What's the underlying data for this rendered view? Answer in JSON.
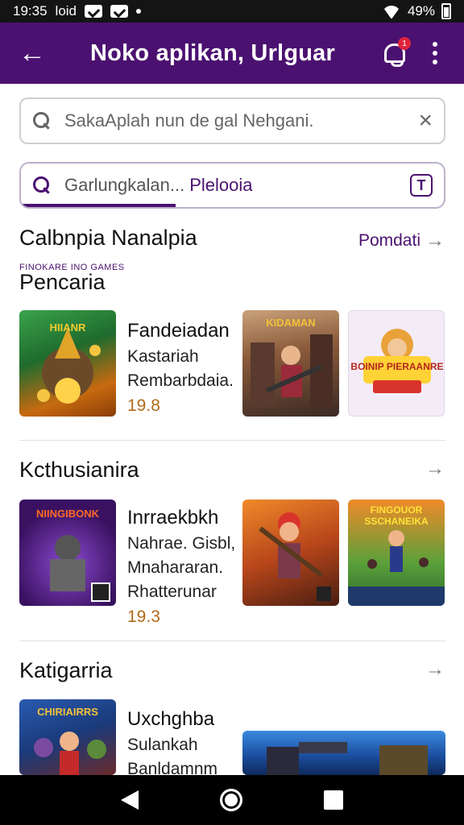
{
  "status_bar": {
    "time": "19:35",
    "net": "loid",
    "battery": "49%"
  },
  "app_bar": {
    "title": "Noko aplikan,  Urlguar",
    "badge_count": "1"
  },
  "search_primary": {
    "placeholder": "SakaAplah nun de gal Nehgani."
  },
  "search_secondary": {
    "text": "Garlungkalan...",
    "highlight": "Plelooia"
  },
  "section_top": {
    "title": "Calbnpia Nanalpia",
    "link": "Pomdati",
    "sub_label": "FINOKARE INO GAMES",
    "sub_title": "Pencaria"
  },
  "rows": [
    {
      "title": "Fandeiadan",
      "line2": "Kastariah",
      "line3": "Rembarbdaia.",
      "rating": "19.8",
      "tiles": [
        "HIIANR",
        "KIDAMAN",
        "BOINIP PIERAANRE"
      ]
    },
    {
      "section": "Kcthusianira",
      "title": "Inrraekbkh",
      "line2": "Nahrae. Gisbl,",
      "line3": "Mnahararan.",
      "line4": "Rhatterunar",
      "rating": "19.3",
      "tiles": [
        "NIINGIBONK",
        "",
        "FINGOUOR SSCHANEIKA"
      ]
    },
    {
      "section": "Katigarria",
      "title": "Uxchghba",
      "line2": "Sulankah",
      "line3": "Banldamnm",
      "tiles": [
        "CHIRIAIRRS",
        ""
      ]
    }
  ],
  "colors": {
    "primary": "#4b1170",
    "accent_rating": "#b06a1a",
    "badge": "#e0233c"
  }
}
